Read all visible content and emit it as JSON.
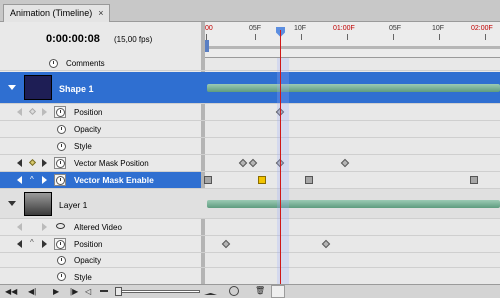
{
  "window": {
    "tab_title": "Animation (Timeline)",
    "close_symbol": "×"
  },
  "header": {
    "timecode": "0:00:00:08",
    "fps": "(15,00 fps)"
  },
  "ruler": {
    "ticks": [
      "00",
      "05F",
      "10F",
      "01:00F",
      "05F",
      "10F",
      "02:00F"
    ]
  },
  "rows": {
    "comments": "Comments",
    "layer1": {
      "name": "Shape 1",
      "props": [
        "Position",
        "Opacity",
        "Style",
        "Vector Mask Position",
        "Vector Mask Enable"
      ]
    },
    "layer2": {
      "name": "Layer 1",
      "props": [
        "Altered Video",
        "Position",
        "Opacity",
        "Style"
      ]
    }
  },
  "colors": {
    "selected_row": "#2f6fd1",
    "playhead": "#d01818",
    "layer_bar": "#6fa88c",
    "enable_key_yellow": "#f2c400"
  }
}
